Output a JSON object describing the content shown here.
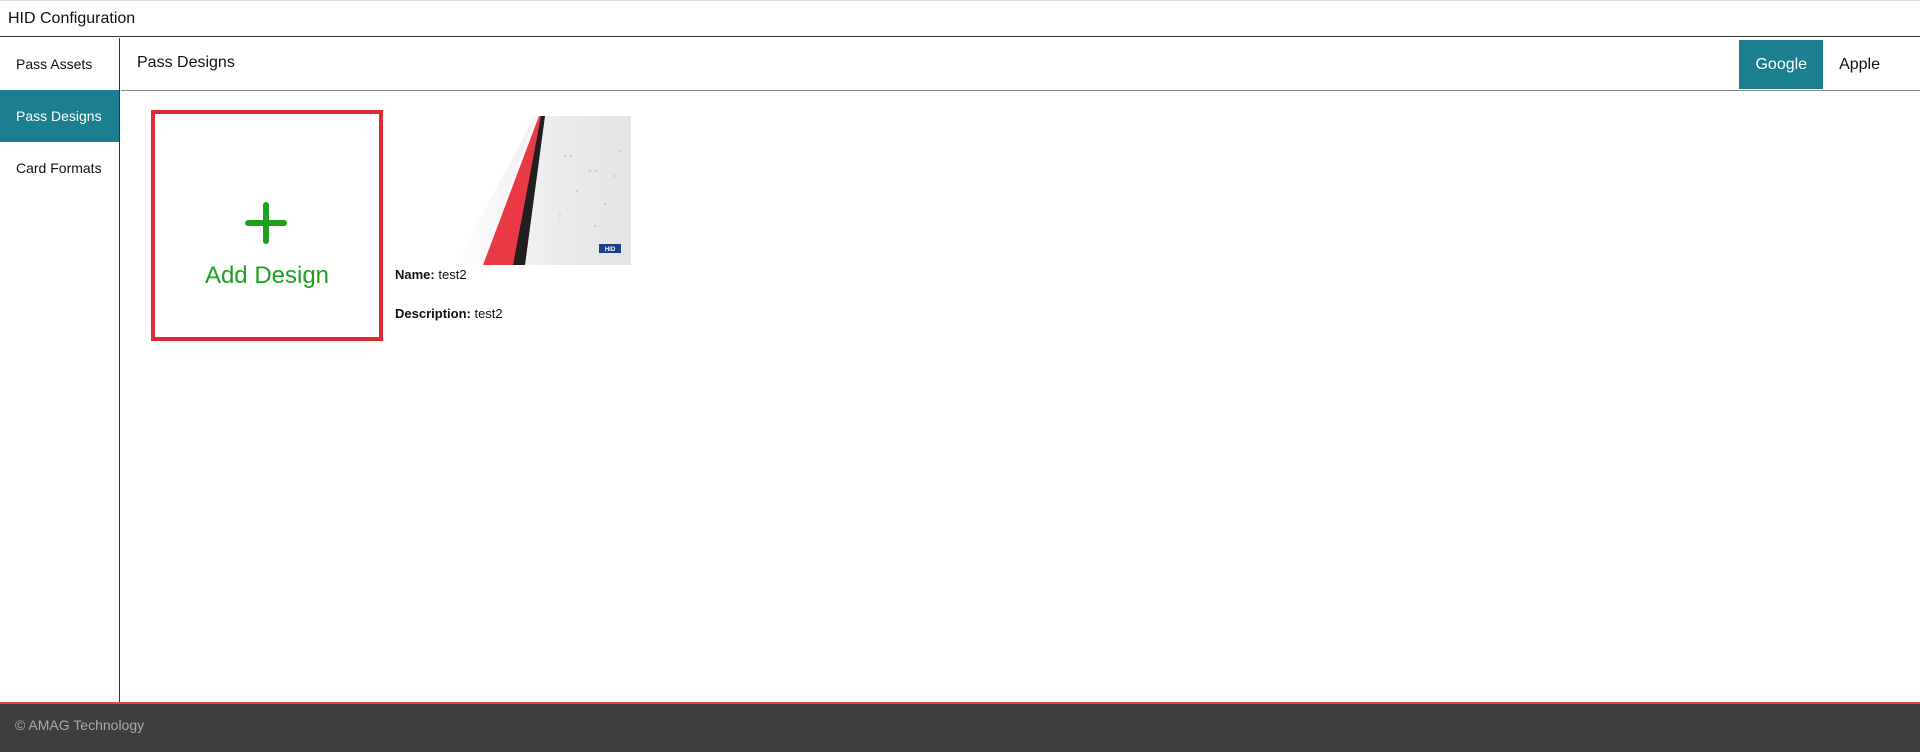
{
  "app": {
    "title": "HID Configuration"
  },
  "sidebar": {
    "items": [
      {
        "label": "Pass Assets"
      },
      {
        "label": "Pass Designs"
      },
      {
        "label": "Card Formats"
      }
    ],
    "active_item": "Pass Designs"
  },
  "header": {
    "title": "Pass Designs",
    "tabs": [
      {
        "label": "Google"
      },
      {
        "label": "Apple"
      }
    ],
    "active_tab": "Google"
  },
  "add_design": {
    "label": "Add Design"
  },
  "designs": [
    {
      "name_label": "Name:",
      "name": "test2",
      "description_label": "Description:",
      "description": "test2",
      "thumb_logo": "HID"
    }
  ],
  "footer": {
    "text": "© AMAG Technology"
  },
  "colors": {
    "accent": "#1b7f8f",
    "add_border": "#e02b35",
    "add_text": "#1ea01e",
    "footer_bg": "#3e3e40",
    "footer_border": "#e0473f"
  }
}
